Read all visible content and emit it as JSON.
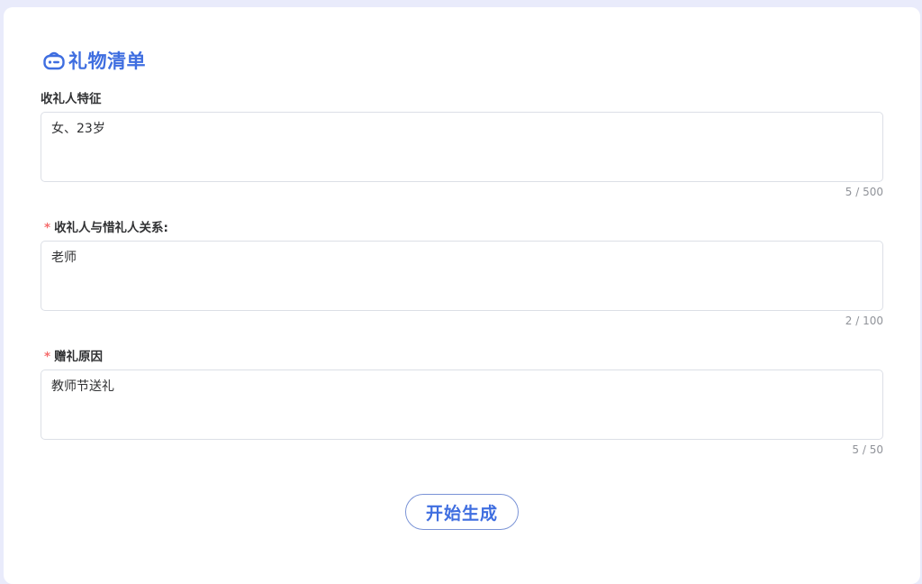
{
  "colors": {
    "accent": "#3f6ee0",
    "required": "#f56c6c",
    "background": "#e9ebfb"
  },
  "header": {
    "icon": "robot-icon",
    "title": "礼物清单"
  },
  "fields": [
    {
      "label": "收礼人特征",
      "required": false,
      "value": "女、23岁",
      "count": "5 / 500"
    },
    {
      "label": "收礼人与惜礼人关系:",
      "required": true,
      "value": "老师",
      "count": "2 / 100"
    },
    {
      "label": "赠礼原因",
      "required": true,
      "value": "教师节送礼",
      "count": "5 / 50"
    }
  ],
  "actions": {
    "generate_label": "开始生成"
  },
  "required_mark": "*"
}
